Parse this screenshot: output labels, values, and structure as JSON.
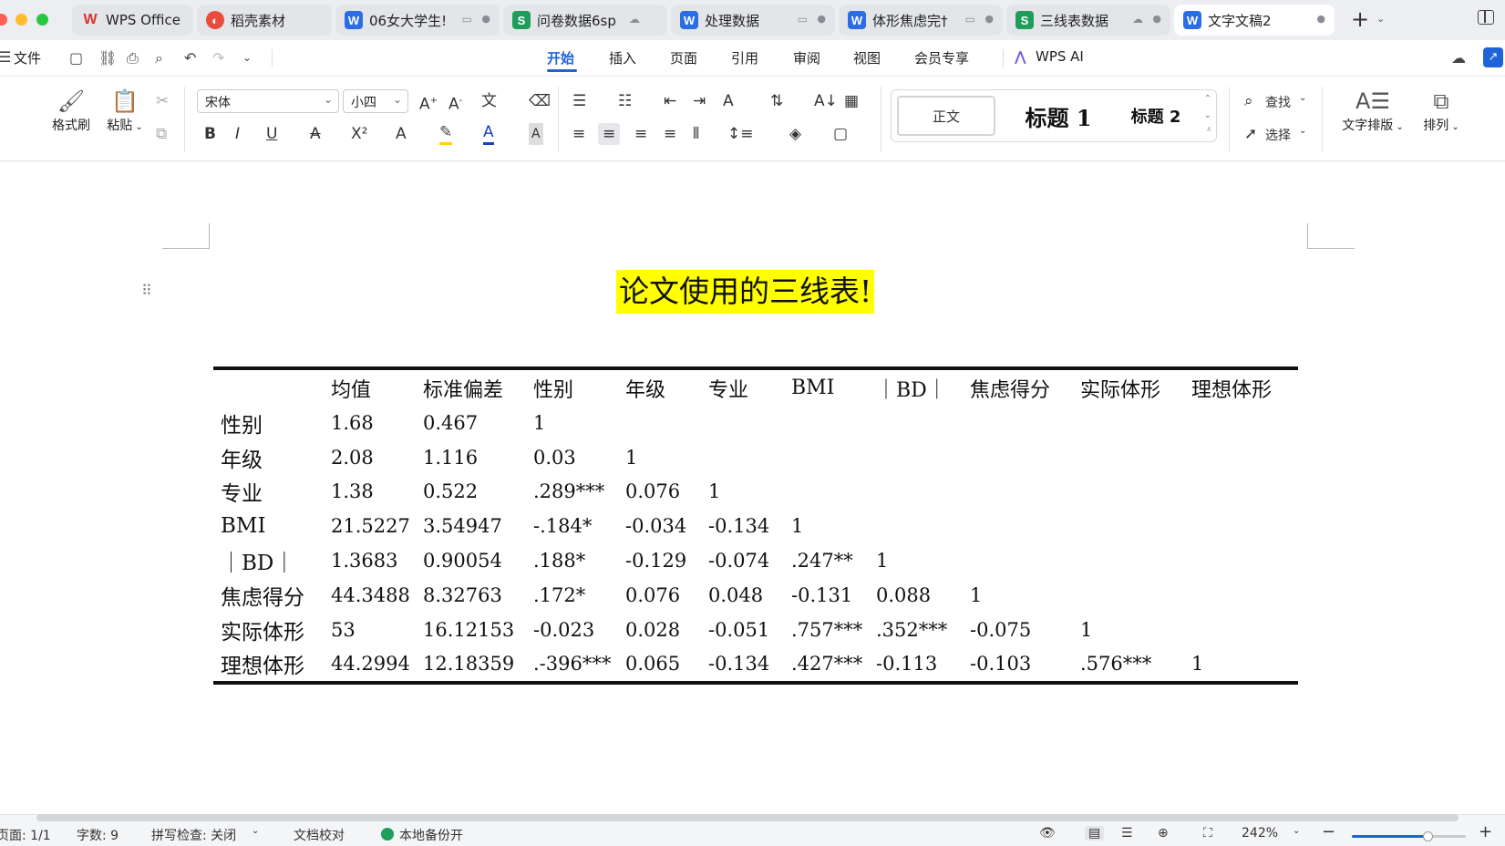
{
  "window": {
    "tabs": [
      {
        "label": "WPS Office",
        "icon": "wps-logo-icon",
        "status": "",
        "active": false
      },
      {
        "label": "稻壳素材",
        "icon": "docer-icon",
        "status": "",
        "active": false
      },
      {
        "label": "06女大学生!",
        "icon": "writer-doc-icon",
        "status": "▭",
        "active": false
      },
      {
        "label": "问卷数据6sp",
        "icon": "sheet-doc-icon",
        "status": "☁",
        "active": false
      },
      {
        "label": "处理数据",
        "icon": "writer-doc-icon",
        "status": "▭",
        "active": false
      },
      {
        "label": "体形焦虑完†",
        "icon": "writer-doc-icon",
        "status": "▭",
        "active": false
      },
      {
        "label": "三线表数据",
        "icon": "sheet-doc-icon",
        "status": "☁",
        "active": false
      },
      {
        "label": "文字文稿2",
        "icon": "writer-doc-icon",
        "status": "",
        "active": true
      }
    ],
    "new_tab_label": "+"
  },
  "menu": {
    "file_label": "文件",
    "items": [
      "开始",
      "插入",
      "页面",
      "引用",
      "审阅",
      "视图",
      "会员专享"
    ],
    "active_item": "开始",
    "ai_label": "WPS AI"
  },
  "ribbon": {
    "format_painter_label": "格式刷",
    "paste_label": "粘贴",
    "font_name": "宋体",
    "font_size": "小四",
    "styles": {
      "normal": "正文",
      "heading1": "标题  1",
      "heading2": "标题  2"
    },
    "find_label": "查找",
    "select_label": "选择",
    "text_layout_label": "文字排版",
    "arrange_label": "排列",
    "bold": "B",
    "italic": "I",
    "underline": "U"
  },
  "document": {
    "title": "论文使用的三线表!",
    "title_highlight_color": "#ffff00",
    "table": {
      "headers": [
        "",
        "均值",
        "标准偏差",
        "性别",
        "年级",
        "专业",
        "BMI",
        "｜BD｜",
        "焦虑得分",
        "实际体形",
        "理想体形"
      ],
      "rows": [
        [
          "性别",
          "1.68",
          "0.467",
          "1",
          "",
          "",
          "",
          "",
          "",
          "",
          ""
        ],
        [
          "年级",
          "2.08",
          "1.116",
          "0.03",
          "1",
          "",
          "",
          "",
          "",
          "",
          ""
        ],
        [
          "专业",
          "1.38",
          "0.522",
          ".289***",
          "0.076",
          "1",
          "",
          "",
          "",
          "",
          ""
        ],
        [
          "BMI",
          "21.5227",
          "3.54947",
          "-.184*",
          "-0.034",
          "-0.134",
          "1",
          "",
          "",
          "",
          ""
        ],
        [
          "｜BD｜",
          "1.3683",
          "0.90054",
          ".188*",
          "-0.129",
          "-0.074",
          ".247**",
          "1",
          "",
          "",
          ""
        ],
        [
          "焦虑得分",
          "44.3488",
          "8.32763",
          ".172*",
          "0.076",
          "0.048",
          "-0.131",
          "0.088",
          "1",
          "",
          ""
        ],
        [
          "实际体形",
          "53",
          "16.12153",
          "-0.023",
          "0.028",
          "-0.051",
          ".757***",
          ".352***",
          "-0.075",
          "1",
          ""
        ],
        [
          "理想体形",
          "44.2994",
          "12.18359",
          ".-396***",
          "0.065",
          "-0.134",
          ".427***",
          "-0.113",
          "-0.103",
          ".576***",
          "1"
        ]
      ]
    }
  },
  "statusbar": {
    "page": "页面: 1/1",
    "word_count": "字数: 9",
    "spell_check": "拼写检查: 关闭",
    "proofread": "文档校对",
    "backup": "本地备份开",
    "zoom": "242%",
    "zoom_fraction": 0.66
  },
  "colors": {
    "accent": "#1f63d8",
    "writer_blue": "#2b6de5",
    "sheet_green": "#1e9e5a",
    "wps_red": "#e0302a"
  }
}
